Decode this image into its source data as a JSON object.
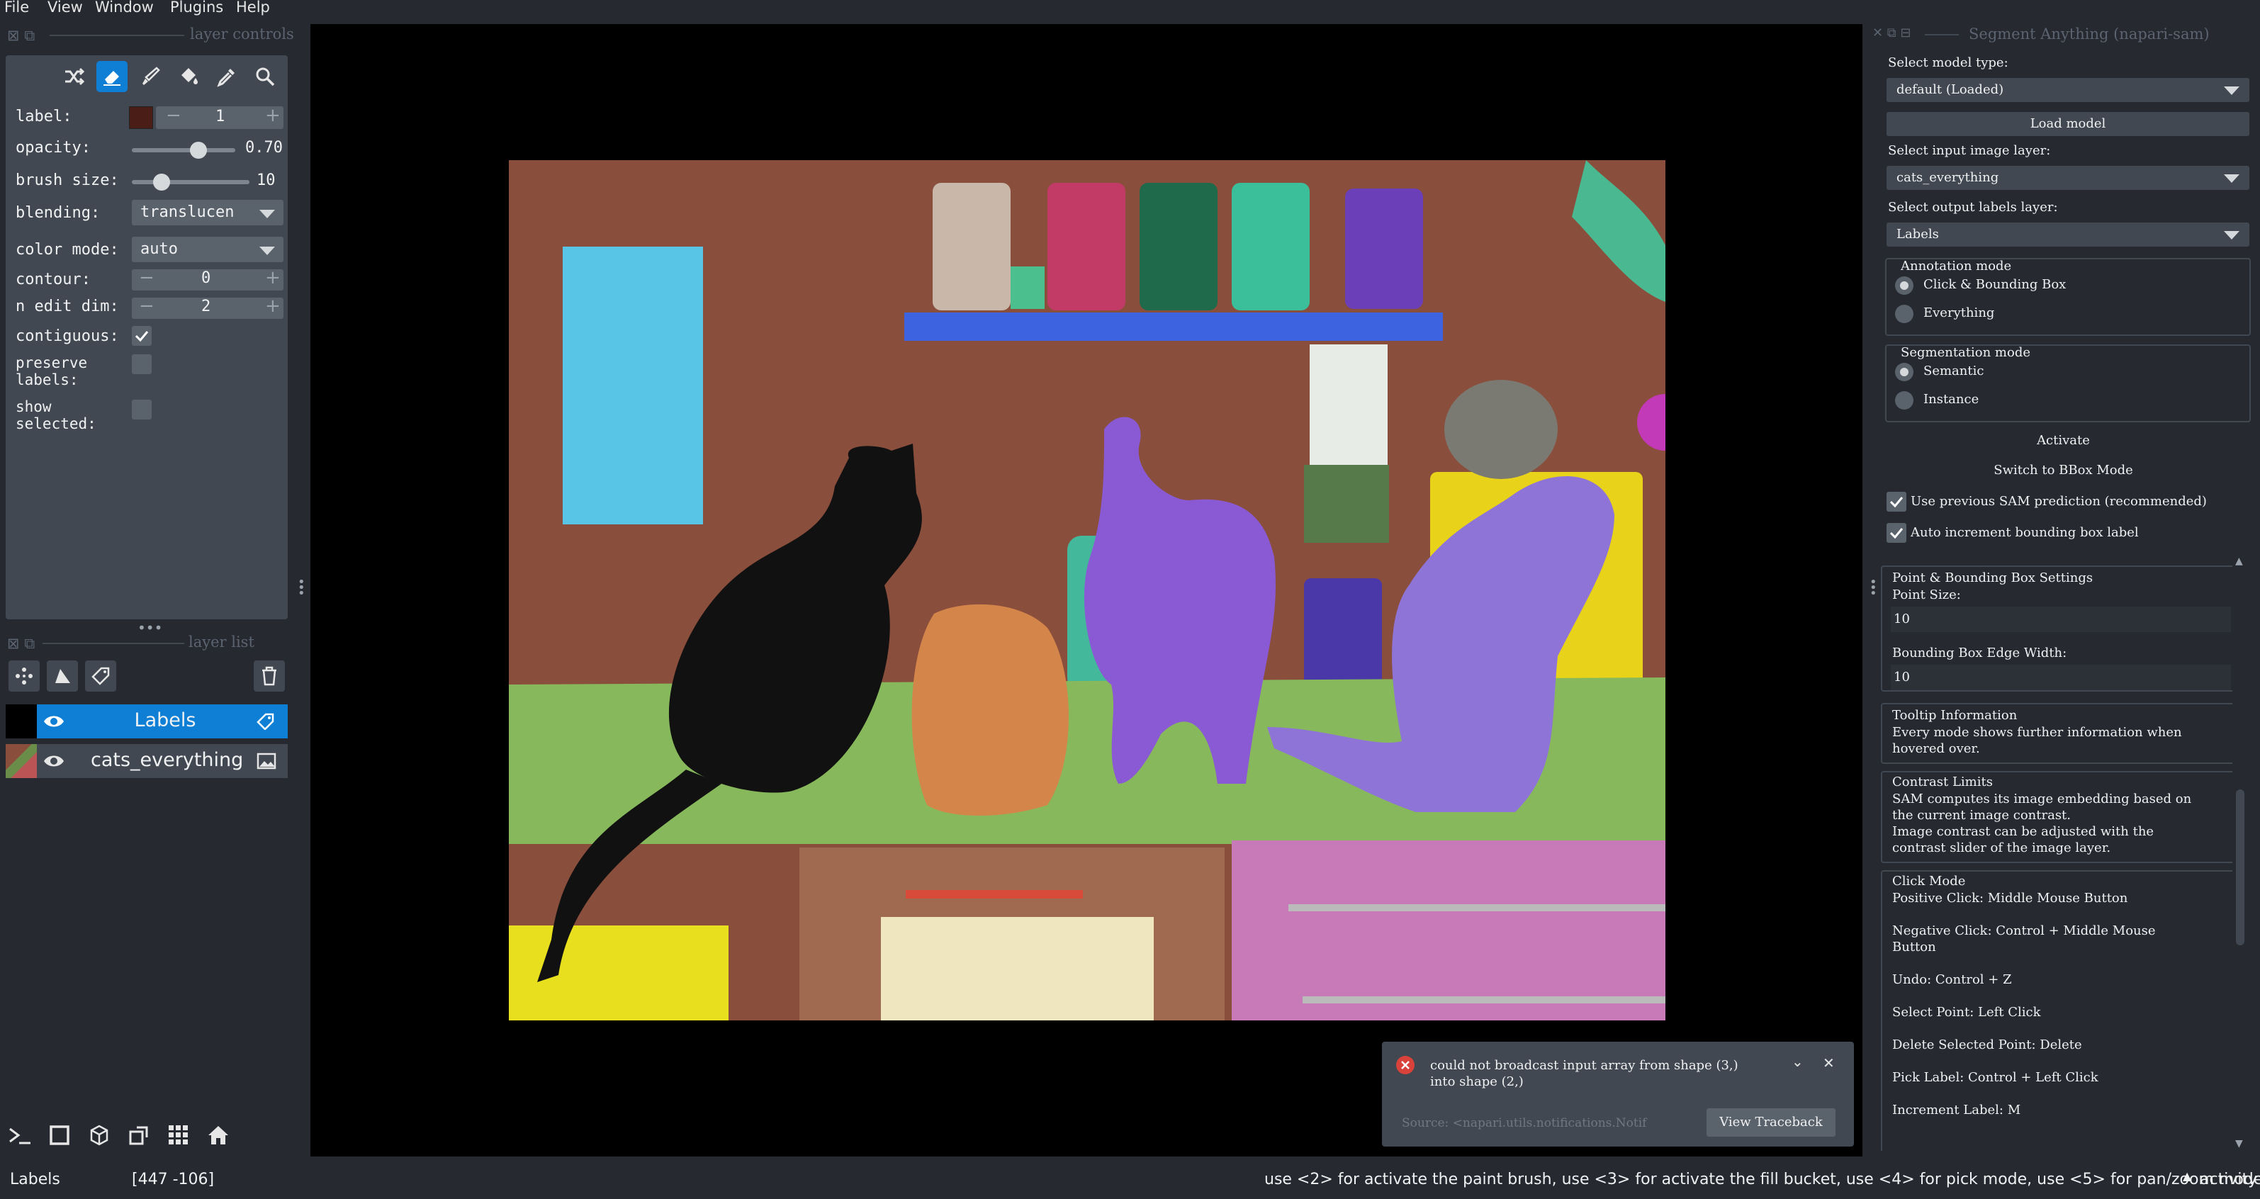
{
  "menu": [
    "File",
    "View",
    "Window",
    "Plugins",
    "Help"
  ],
  "layer_controls": {
    "title": "layer controls",
    "tools": [
      "shuffle-icon",
      "eraser-icon",
      "paintbrush-icon",
      "fill-bucket-icon",
      "color-picker-icon",
      "zoom-icon"
    ],
    "label": {
      "name": "label:",
      "value": "1",
      "minus": "−",
      "plus": "+"
    },
    "opacity": {
      "name": "opacity:",
      "value": "0.70",
      "level": 0.7
    },
    "brush_size": {
      "name": "brush size:",
      "value": "10",
      "level": 0.2
    },
    "blending": {
      "name": "blending:",
      "value": "translucen"
    },
    "color_mode": {
      "name": "color mode:",
      "value": "auto"
    },
    "contour": {
      "name": "contour:",
      "value": "0",
      "minus": "−",
      "plus": "+"
    },
    "n_edit_dim": {
      "name": "n edit dim:",
      "value": "2",
      "minus": "−",
      "plus": "+"
    },
    "contiguous": {
      "name": "contiguous:",
      "checked": true
    },
    "preserve_labels": {
      "name": "preserve\nlabels:",
      "checked": false
    },
    "show_selected": {
      "name": "show\nselected:",
      "checked": false
    }
  },
  "layer_list": {
    "title": "layer list",
    "layers": [
      {
        "name": "Labels",
        "type": "labels",
        "selected": true,
        "visible": true
      },
      {
        "name": "cats_everything",
        "type": "image",
        "selected": false,
        "visible": true
      }
    ]
  },
  "sam_panel": {
    "title": "Segment Anything (napari-sam)",
    "model_type_label": "Select model type:",
    "model_type_value": "default (Loaded)",
    "load_model_button": "Load model",
    "input_layer_label": "Select input image layer:",
    "input_layer_value": "cats_everything",
    "output_layer_label": "Select output labels layer:",
    "output_layer_value": "Labels",
    "annotation_mode": {
      "title": "Annotation mode",
      "options": [
        "Click & Bounding Box",
        "Everything"
      ],
      "selected": 0
    },
    "segmentation_mode": {
      "title": "Segmentation mode",
      "options": [
        "Semantic",
        "Instance"
      ],
      "selected": 0
    },
    "activate_button": "Activate",
    "switch_bbox_button": "Switch to BBox Mode",
    "use_prev_prediction": {
      "label": "Use previous SAM prediction (recommended)",
      "checked": true
    },
    "auto_increment": {
      "label": "Auto increment bounding box label",
      "checked": true
    },
    "settings": {
      "title": "Point & Bounding Box Settings",
      "point_size_label": "Point Size:",
      "point_size_value": "10",
      "bbox_edge_label": "Bounding Box Edge Width:",
      "bbox_edge_value": "10"
    },
    "tooltip": {
      "title": "Tooltip Information",
      "text": "Every mode shows further information when\nhovered over."
    },
    "contrast": {
      "title": "Contrast Limits",
      "text": "SAM computes its image embedding based on\nthe current image contrast.\nImage contrast can be adjusted with the\ncontrast slider of the image layer."
    },
    "click_mode": {
      "title": "Click Mode",
      "text": "Positive Click: Middle Mouse Button\n\nNegative Click: Control + Middle Mouse\nButton\n\nUndo: Control + Z\n\nSelect Point: Left Click\n\nDelete Selected Point: Delete\n\nPick Label: Control + Left Click\n\nIncrement Label: M"
    }
  },
  "notification": {
    "message": "could not broadcast input array from shape (3,)\ninto shape (2,)",
    "source": "Source: <napari.utils.notifications.Notif",
    "traceback_button": "View Traceback"
  },
  "status": {
    "layer": "Labels",
    "coords": "[447 -106]",
    "hint": "use <2> for activate the paint brush, use <3> for activate the fill bucket, use <4> for pick mode, use <5> for pan/zoom mode",
    "activity": "activity"
  },
  "colors": {
    "accent": "#0f7fd6",
    "panel": "#414851",
    "bg": "#262930",
    "error": "#d8423a"
  }
}
